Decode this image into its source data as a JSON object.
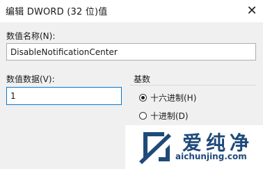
{
  "window": {
    "title": "编辑 DWORD (32 位)值",
    "close_glyph": "✕"
  },
  "value_name": {
    "label": "数值名称(N):",
    "value": "DisableNotificationCenter"
  },
  "value_data": {
    "label": "数值数据(V):",
    "value": "1"
  },
  "base": {
    "label": "基数",
    "options": [
      {
        "label": "十六进制(H)",
        "checked": true
      },
      {
        "label": "十进制(D)",
        "checked": false
      }
    ]
  },
  "watermark": {
    "text_cn": "爱纯净",
    "url": "aichunjing.com"
  },
  "colors": {
    "focus_border": "#0078d7",
    "watermark_blue": "#1f4a7a"
  }
}
